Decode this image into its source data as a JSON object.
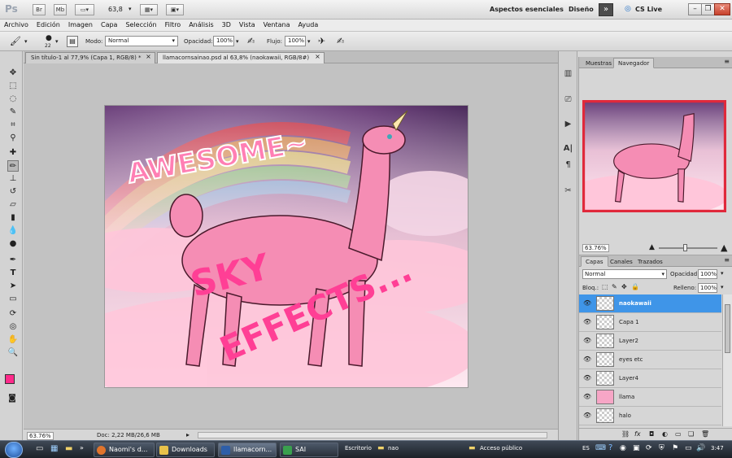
{
  "appbar": {
    "logo": "Ps",
    "btn_br": "Br",
    "btn_mb": "Mb",
    "zoom": "63,8",
    "workspace_essentials": "Aspectos esenciales",
    "workspace_design": "Diseño",
    "cs_live": "CS Live"
  },
  "menu": [
    "Archivo",
    "Edición",
    "Imagen",
    "Capa",
    "Selección",
    "Filtro",
    "Análisis",
    "3D",
    "Vista",
    "Ventana",
    "Ayuda"
  ],
  "options": {
    "brush_size": "22",
    "mode_label": "Modo:",
    "mode_value": "Normal",
    "opacity_label": "Opacidad:",
    "opacity_value": "100%",
    "flow_label": "Flujo:",
    "flow_value": "100%"
  },
  "doc_tabs": [
    {
      "label": "Sin título-1 al 77,9% (Capa 1, RGB/8) *"
    },
    {
      "label": "llamacornsainao.psd al 63,8% (naokawaii, RGB/8#)"
    }
  ],
  "artwork": {
    "text_awesome": "AWESOME~",
    "text_sky": "SKY",
    "text_effects": "EFFECTS..."
  },
  "status": {
    "zoom": "63.76%",
    "doc": "Doc: 2,22 MB/26,6 MB"
  },
  "navigator": {
    "tab_samples": "Muestras",
    "tab_navigator": "Navegador",
    "zoom": "63.76%"
  },
  "layers": {
    "tab_layers": "Capas",
    "tab_channels": "Canales",
    "tab_paths": "Trazados",
    "blend_mode": "Normal",
    "opacity_label": "Opacidad:",
    "opacity_value": "100%",
    "lock_label": "Bloq.:",
    "fill_label": "Relleno:",
    "fill_value": "100%",
    "items": [
      {
        "name": "naokawaii",
        "selected": true
      },
      {
        "name": "Capa 1"
      },
      {
        "name": "Layer2"
      },
      {
        "name": "eyes etc"
      },
      {
        "name": "Layer4"
      },
      {
        "name": "llama"
      },
      {
        "name": "halo"
      }
    ]
  },
  "taskbar": {
    "items": [
      {
        "label": "Naomi's d...",
        "color": "#e0742c"
      },
      {
        "label": "Downloads",
        "color": "#e8c24a"
      },
      {
        "label": "llamacorn...",
        "color": "#2e5ea8"
      },
      {
        "label": "SAI",
        "color": "#3aa04e"
      }
    ],
    "desktop": "Escritorio",
    "user": "nao",
    "public_access": "Acceso público",
    "lang": "ES",
    "clock": "3:47"
  }
}
